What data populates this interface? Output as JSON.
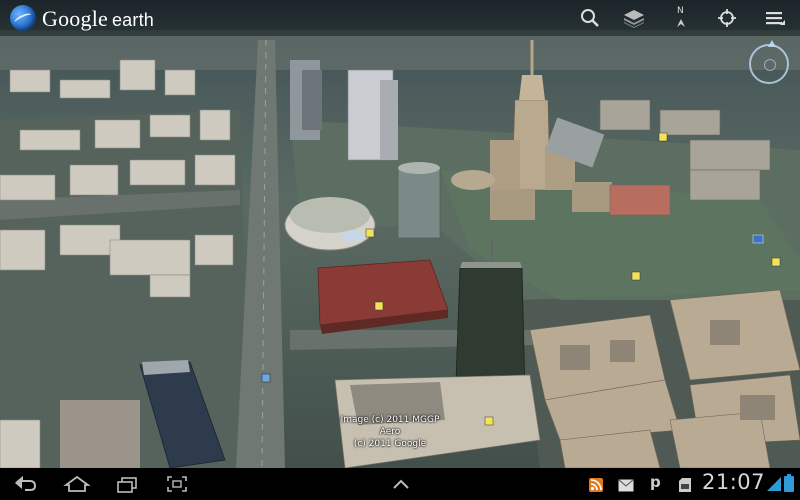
{
  "app": {
    "logo_word_google": "Google",
    "logo_word_earth": "earth"
  },
  "toolbar": {
    "icons": [
      "search-icon",
      "layers-icon",
      "north-arrow-icon",
      "my-location-icon",
      "menu-icon"
    ],
    "north_label": "N"
  },
  "map": {
    "attribution_line1": "Image (c) 2011 MGGP Aero",
    "attribution_line2": "(c) 2011 Google",
    "colors": {
      "ground": "#5a6a63",
      "road": "#6f7873",
      "roof_red": "#8a3b35",
      "building_light": "#cfcac0"
    }
  },
  "system_bar": {
    "nav_icons": [
      "back-icon",
      "home-icon",
      "recent-apps-icon",
      "screenshot-icon",
      "expand-up-icon"
    ],
    "status_icons": [
      "rss-icon",
      "gmail-icon",
      "p-icon",
      "sd-card-icon",
      "wifi-icon",
      "battery-icon"
    ],
    "p_label": "p",
    "time": "21:07"
  }
}
